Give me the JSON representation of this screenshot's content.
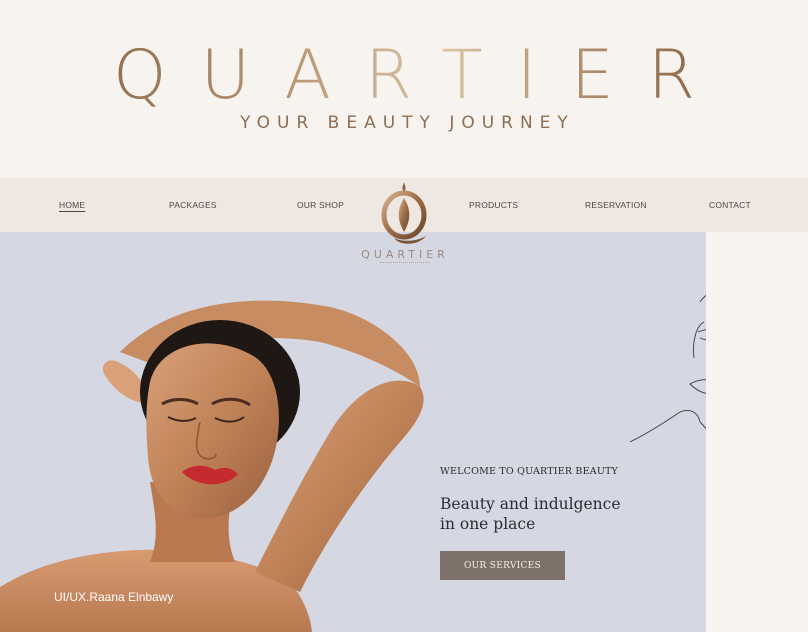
{
  "brand": {
    "title": "QUARTIER",
    "tagline": "YOUR BEAUTY JOURNEY"
  },
  "nav": {
    "items": [
      {
        "label": "HOME",
        "active": true
      },
      {
        "label": "PACKAGES",
        "active": false
      },
      {
        "label": "OUR SHOP",
        "active": false
      },
      {
        "label": "PRODUCTS",
        "active": false
      },
      {
        "label": "RESERVATION",
        "active": false
      },
      {
        "label": "CONTACT",
        "active": false
      }
    ]
  },
  "logo": {
    "word": "QUARTIER",
    "icon": "drop-emblem-icon"
  },
  "hero": {
    "welcome": "WELCOME TO QUARTIER BEAUTY",
    "headline_line1": "Beauty and indulgence",
    "headline_line2": "in one place",
    "cta_label": "OUR SERVICES",
    "credit": "UI/UX.Raana Elnbawy",
    "line_art_icon": "face-line-art-icon"
  },
  "colors": {
    "background": "#f7f4ef",
    "nav_background": "#efe8e2",
    "hero_background": "#d5d8e2",
    "button": "#7e7169",
    "gold_accent": "#b89472"
  }
}
